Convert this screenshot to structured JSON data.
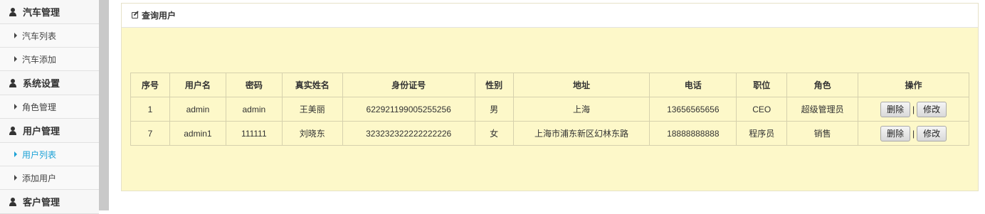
{
  "sidebar": {
    "sections": [
      {
        "title": "汽车管理",
        "items": [
          "汽车列表",
          "汽车添加"
        ]
      },
      {
        "title": "系统设置",
        "items": [
          "角色管理"
        ]
      },
      {
        "title": "用户管理",
        "items": [
          "用户列表",
          "添加用户"
        ],
        "active_item": "用户列表"
      },
      {
        "title": "客户管理",
        "items": []
      }
    ]
  },
  "panel": {
    "title": "查询用户",
    "title_icon": "edit-icon"
  },
  "table": {
    "headers": [
      "序号",
      "用户名",
      "密码",
      "真实姓名",
      "身份证号",
      "性别",
      "地址",
      "电话",
      "职位",
      "角色",
      "操作"
    ],
    "rows": [
      [
        "1",
        "admin",
        "admin",
        "王美丽",
        "622921199005255256",
        "男",
        "上海",
        "13656565656",
        "CEO",
        "超级管理员"
      ],
      [
        "7",
        "admin1",
        "111111",
        "刘晓东",
        "323232322222222226",
        "女",
        "上海市浦东新区幻林东路",
        "18888888888",
        "程序员",
        "销售"
      ]
    ],
    "actions": {
      "delete": "删除",
      "separator": "|",
      "edit": "修改"
    }
  },
  "colors": {
    "panel_bg": "#fdf8c9",
    "active_link": "#1ba1d6",
    "sidebar_bg": "#f2f2f2"
  }
}
